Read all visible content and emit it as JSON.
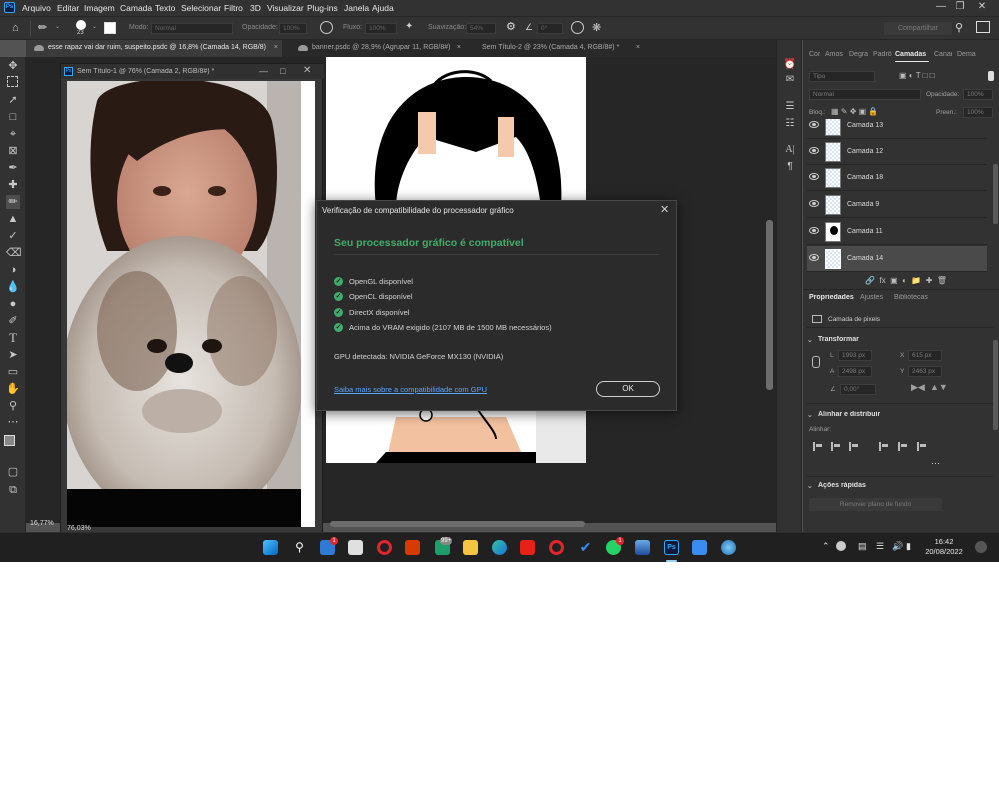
{
  "menubar": {
    "app_icon": "Ps",
    "items": [
      "Arquivo",
      "Editar",
      "Imagem",
      "Camada",
      "Texto",
      "Selecionar",
      "Filtro",
      "3D",
      "Visualizar",
      "Plug-ins",
      "Janela",
      "Ajuda"
    ]
  },
  "options": {
    "brush_size": "23",
    "mode_label": "Modo:",
    "mode_value": "Normal",
    "opacity_label": "Opacidade:",
    "opacity_value": "100%",
    "flow_label": "Fluxo:",
    "flow_value": "100%",
    "smoothing_label": "Suavização:",
    "smoothing_value": "54%",
    "angle_value": "0°",
    "share_label": "Compartilhar"
  },
  "tabs": [
    {
      "label": "esse rapaz vai dar ruim, suspeito.psdc @ 16,8% (Camada 14, RGB/8)",
      "active": true
    },
    {
      "label": "banner.psdc @ 28,9% (Agrupar 11, RGB/8#)",
      "active": false
    },
    {
      "label": "Sem Título-2 @ 23% (Camada 4, RGB/8#) *",
      "active": false
    }
  ],
  "floating_window": {
    "title": "Sem Título-1 @ 76% (Camada 2, RGB/8#) *",
    "zoom": "76,03%"
  },
  "status": {
    "zoom": "16,77%"
  },
  "panels": {
    "tabs": [
      "Cor",
      "Amos",
      "Degra",
      "Padrõ",
      "Camadas",
      "Canai",
      "Dema"
    ],
    "active_tab": "Camadas",
    "filter_placeholder": "Tipo",
    "blend_mode": "Normal",
    "opacity_label": "Opacidade:",
    "opacity_value": "100%",
    "lock_label": "Bloq.:",
    "fill_label": "Preen.:",
    "fill_value": "100%",
    "layers": [
      "Camada 13",
      "Camada 12",
      "Camada 18",
      "Camada 9",
      "Camada 11",
      "Camada 14"
    ],
    "selected_layer": "Camada 14"
  },
  "properties": {
    "tabs": [
      "Propriedades",
      "Ajustes",
      "Bibliotecas"
    ],
    "layer_type": "Camada de pixels",
    "transform_title": "Transformar",
    "w_label": "L",
    "w_value": "1993 px",
    "x_label": "X",
    "x_value": "615 px",
    "h_label": "A",
    "h_value": "2498 px",
    "y_label": "Y",
    "y_value": "2463 px",
    "angle_value": "0,00°",
    "align_title": "Alinhar e distribuir",
    "align_label": "Alinhar:",
    "quick_title": "Ações rápidas",
    "remove_bg": "Remover plano de fundo"
  },
  "dialog": {
    "title": "Verificação de compatibilidade do processador gráfico",
    "heading": "Seu processador gráfico é compatível",
    "checks": [
      "OpenGL disponível",
      "OpenCL disponível",
      "DirectX disponível",
      "Acima do VRAM exigido (2107 MB de 1500 MB necessários)"
    ],
    "gpu_detected": "GPU detectada: NVIDIA GeForce MX130 (NVIDIA)",
    "learn_more": "Saiba mais sobre a compatibilidade com GPU",
    "ok": "OK"
  },
  "taskbar": {
    "mail_badge": "1",
    "tv_badge": "99+",
    "whatsapp_badge": "1",
    "time": "16:42",
    "date": "20/08/2022"
  },
  "colors": {
    "accent_green": "#3fae6a",
    "link_blue": "#5aa6ff",
    "ps_blue": "#31a8ff",
    "panel_bg": "#323232"
  }
}
